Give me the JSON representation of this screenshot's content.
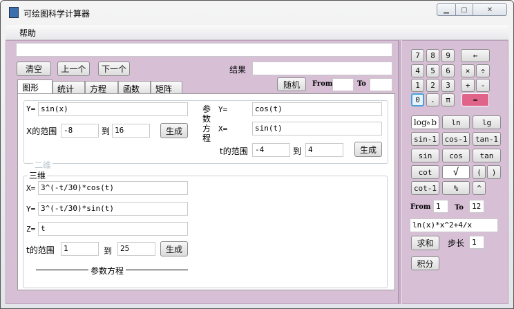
{
  "title": "可绘图科学计算器",
  "menu": [
    "帮助"
  ],
  "toolbar": {
    "expression": "",
    "clear": "清空",
    "prev": "上一个",
    "next": "下一个",
    "result_label": "结果",
    "result": ""
  },
  "tabs": [
    "图形",
    "统计",
    "方程",
    "函数",
    "矩阵"
  ],
  "random": {
    "label": "随机",
    "from_label": "From",
    "from": "",
    "to_label": "To",
    "to": ""
  },
  "graph2d": {
    "group_label": "二维",
    "y_label": "Y=",
    "y": "sin(x)",
    "range_label": "X的范围",
    "from": "-8",
    "to_label": "到",
    "to": "16",
    "generate": "生成",
    "param_label": "参数方程",
    "py_label": "Y=",
    "py": "cos(t)",
    "px_label": "X=",
    "px": "sin(t)",
    "t_label": "t的范围",
    "t_from": "-4",
    "t_to_label": "到",
    "t_to": "4",
    "generate2": "生成"
  },
  "graph3d": {
    "group_label": "三维",
    "x_label": "X=",
    "x": "3^(-t/30)*cos(t)",
    "y_label": "Y=",
    "y": "3^(-t/30)*sin(t)",
    "z_label": "Z=",
    "z": "t",
    "t_label": "t的范围",
    "t_from": "1",
    "to_label": "到",
    "t_to": "25",
    "generate": "生成",
    "caption": "参数方程"
  },
  "keypad": {
    "digits": [
      "7",
      "8",
      "9",
      "4",
      "5",
      "6",
      "1",
      "2",
      "3",
      "0",
      ".",
      "π"
    ],
    "back": "←",
    "mul": "×",
    "div": "÷",
    "add": "+",
    "sub": "-",
    "eq": "="
  },
  "functions": [
    "log",
    "ln",
    "lg",
    "sin-1",
    "cos-1",
    "tan-1",
    "sin",
    "cos",
    "tan",
    "cot",
    "√",
    "(",
    ")",
    "cot-1",
    "%",
    "^"
  ],
  "log_sub": "a",
  "log_b": "b",
  "series": {
    "from_label": "From",
    "from": "1",
    "to_label": "To",
    "to": "12",
    "expression": "ln(x)*x^2+4/x",
    "sum": "求和",
    "step_label": "步长",
    "step": "1",
    "integral": "积分"
  },
  "colors": {
    "background": "#d7bfd6",
    "equals": "#e0638a"
  }
}
